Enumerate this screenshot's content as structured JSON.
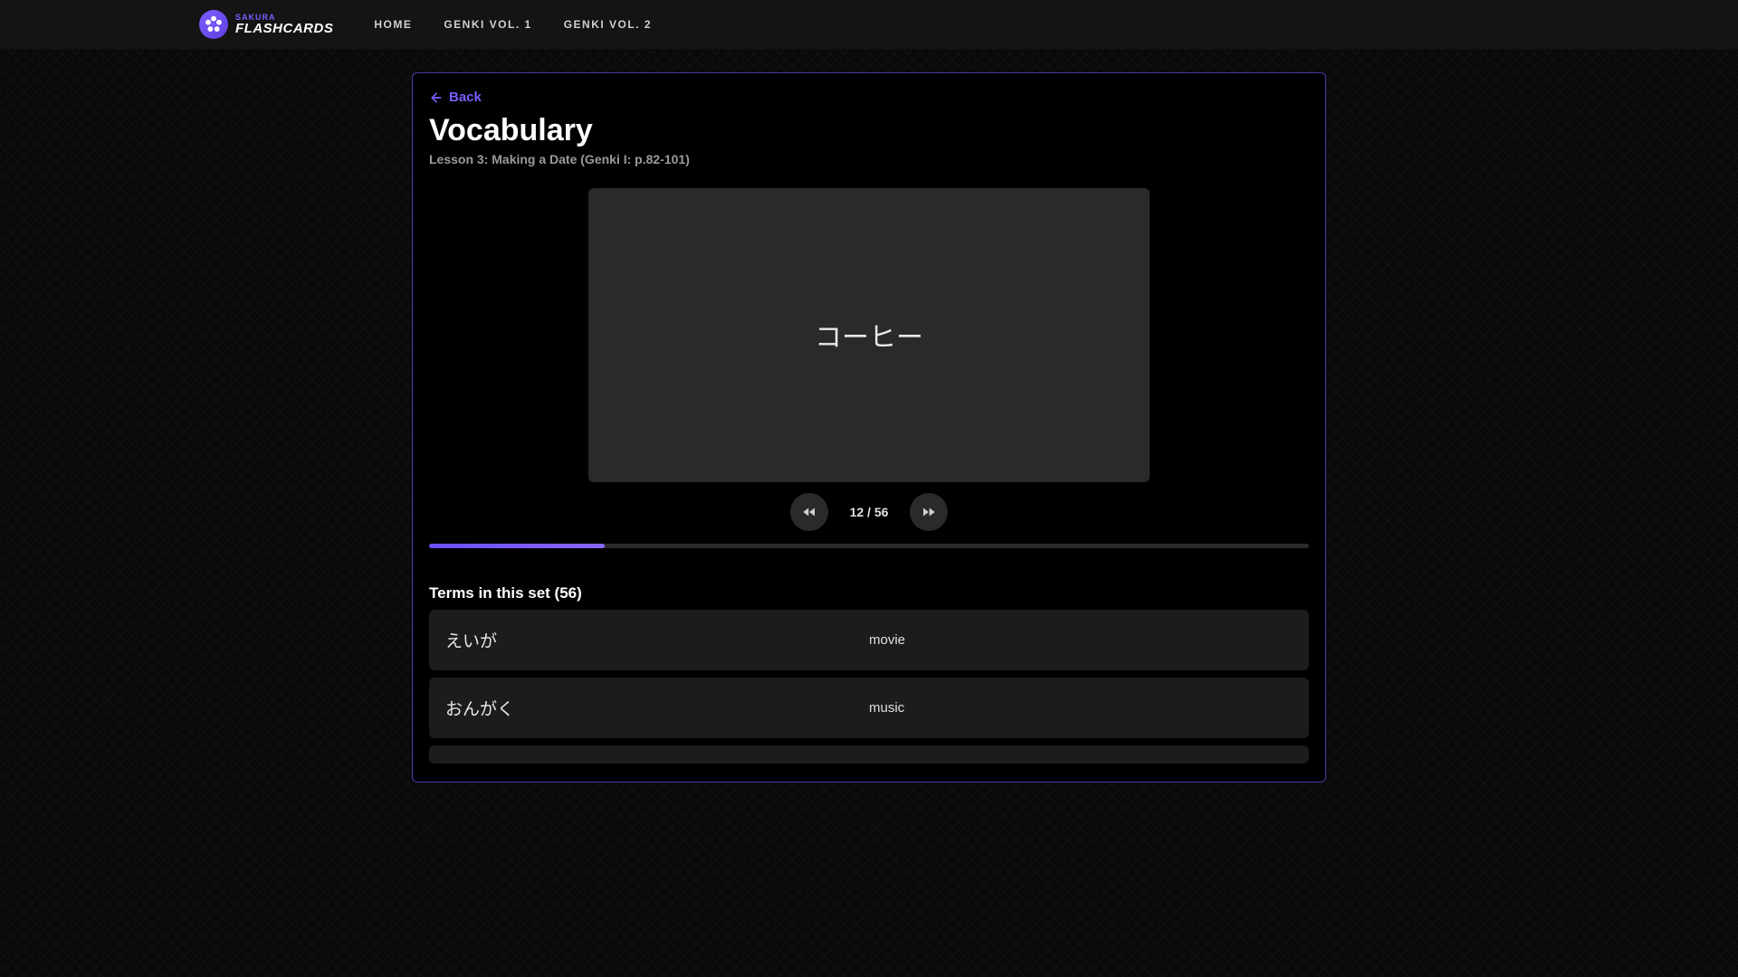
{
  "brand": {
    "top": "SAKURA",
    "bottom": "FLASHCARDS"
  },
  "nav": {
    "home": "HOME",
    "genki1": "GENKI VOL. 1",
    "genki2": "GENKI VOL. 2"
  },
  "back_label": "Back",
  "title": "Vocabulary",
  "subtitle": "Lesson 3: Making a Date (Genki I: p.82-101)",
  "card_text": "コーヒー",
  "counter": "12 / 56",
  "progress_percent": 20,
  "terms_heading": "Terms in this set (56)",
  "terms": [
    {
      "jp": "えいが",
      "en": "movie"
    },
    {
      "jp": "おんがく",
      "en": "music"
    }
  ]
}
